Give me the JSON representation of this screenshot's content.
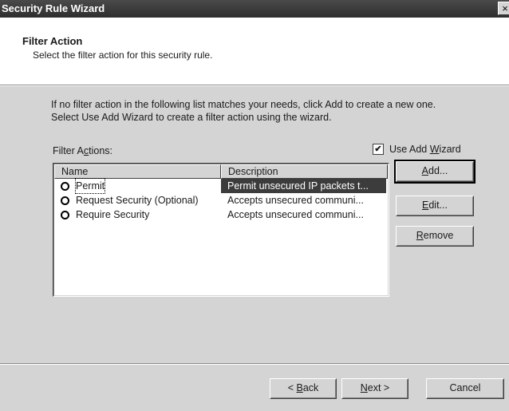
{
  "window": {
    "title": "Security Rule Wizard",
    "close_glyph": "×"
  },
  "header": {
    "title": "Filter Action",
    "subtitle": "Select the filter action for this security rule."
  },
  "intro": {
    "line1": "If no filter action in the following list matches your needs, click Add to create a new one.",
    "line2": "Select Use Add Wizard to create a filter action using the wizard."
  },
  "filter_actions_label": {
    "pre": "Filter A",
    "accel": "c",
    "post": "tions:"
  },
  "use_add_wizard": {
    "checked": true,
    "check_glyph": "✔",
    "pre": "Use Add ",
    "accel": "W",
    "post": "izard"
  },
  "list": {
    "columns": [
      "Name",
      "Description"
    ],
    "rows": [
      {
        "name": "Permit",
        "description": "Permit unsecured IP packets t...",
        "selected": true
      },
      {
        "name": "Request Security (Optional)",
        "description": "Accepts unsecured communi...",
        "selected": false
      },
      {
        "name": "Require Security",
        "description": "Accepts unsecured communi...",
        "selected": false
      }
    ]
  },
  "side_buttons": {
    "add": {
      "accel": "A",
      "post": "dd..."
    },
    "edit": {
      "accel": "E",
      "post": "dit..."
    },
    "remove": {
      "accel": "R",
      "post": "emove"
    }
  },
  "footer_buttons": {
    "back": {
      "pre": "< ",
      "accel": "B",
      "post": "ack"
    },
    "next": {
      "accel": "N",
      "post": "ext >"
    },
    "cancel": "Cancel"
  }
}
